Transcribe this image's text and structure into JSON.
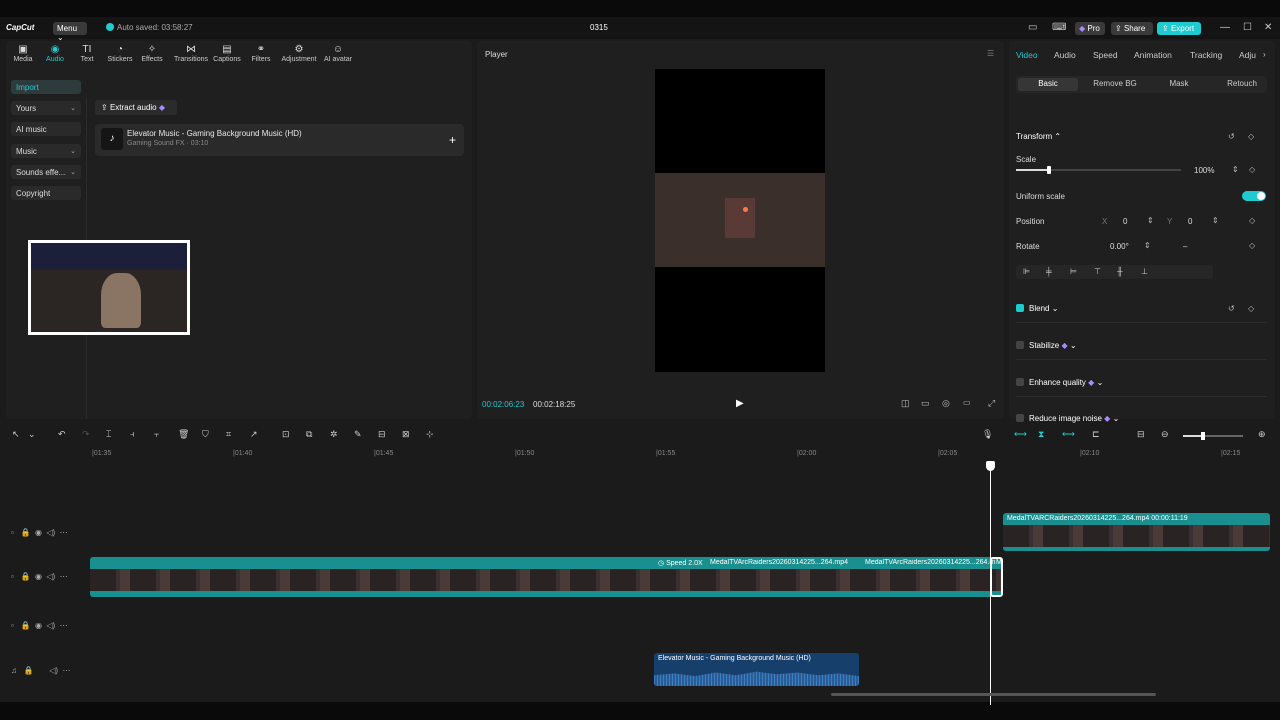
{
  "titlebar": {
    "logo": "CapCut",
    "menu": "Menu",
    "autosave": "Auto saved: 03:58:27",
    "project_title": "0315",
    "pro": "Pro",
    "share": "Share",
    "export": "Export"
  },
  "toolbar": [
    {
      "label": "Media",
      "icon": "media-icon"
    },
    {
      "label": "Audio",
      "icon": "audio-icon"
    },
    {
      "label": "Text",
      "icon": "text-icon"
    },
    {
      "label": "Stickers",
      "icon": "stickers-icon"
    },
    {
      "label": "Effects",
      "icon": "effects-icon"
    },
    {
      "label": "Transitions",
      "icon": "transitions-icon"
    },
    {
      "label": "Captions",
      "icon": "captions-icon"
    },
    {
      "label": "Filters",
      "icon": "filters-icon"
    },
    {
      "label": "Adjustment",
      "icon": "adjustment-icon"
    },
    {
      "label": "AI avatar",
      "icon": "ai-avatar-icon"
    }
  ],
  "sidebar": {
    "items": [
      "Import",
      "Yours",
      "AI music",
      "Music",
      "Sounds effe...",
      "Copyright"
    ]
  },
  "media": {
    "extract_audio": "Extract audio",
    "track_title": "Elevator Music - Gaming Background Music (HD)",
    "track_sub": "Gaming Sound FX · 03:10"
  },
  "player": {
    "title": "Player",
    "current_time": "00:02:06:23",
    "total_time": "00:02:18:25"
  },
  "right_panel": {
    "tabs": [
      "Video",
      "Audio",
      "Speed",
      "Animation",
      "Tracking",
      "Adju"
    ],
    "subtabs": [
      "Basic",
      "Remove BG",
      "Mask",
      "Retouch"
    ],
    "transform": "Transform",
    "scale_label": "Scale",
    "scale_value": "100%",
    "scale_fraction": 0.2,
    "uniform_scale": "Uniform scale",
    "position_label": "Position",
    "pos_x_label": "X",
    "pos_x": "0",
    "pos_y_label": "Y",
    "pos_y": "0",
    "rotate_label": "Rotate",
    "rotate_value": "0.00°",
    "rotate_minus": "–",
    "blend": "Blend",
    "stabilize": "Stabilize",
    "enhance_quality": "Enhance quality",
    "reduce_noise": "Reduce image noise"
  },
  "timeline": {
    "ruler": [
      "|01:35",
      "|01:40",
      "|01:45",
      "|01:50",
      "|01:55",
      "|02:00",
      "|02:05",
      "|02:10",
      "|02:15"
    ],
    "clip_top_label": "MedalTVARCRaiders20260314225...264.mp4  00:00:11:19",
    "clip_main_speed": "Speed 2.0X",
    "clip_main_label1": "MedalTVArcRaiders20260314225...264.mp4",
    "clip_main_label2": "MedalTVArcRaiders20260314225...264.mp4",
    "clip_main_label3": "M",
    "clip_audio_label": "Elevator Music - Gaming Background Music (HD)"
  },
  "colors": {
    "accent": "#1ecbd0",
    "video_clip": "#1a8f8f",
    "audio_clip": "#173f6b"
  }
}
